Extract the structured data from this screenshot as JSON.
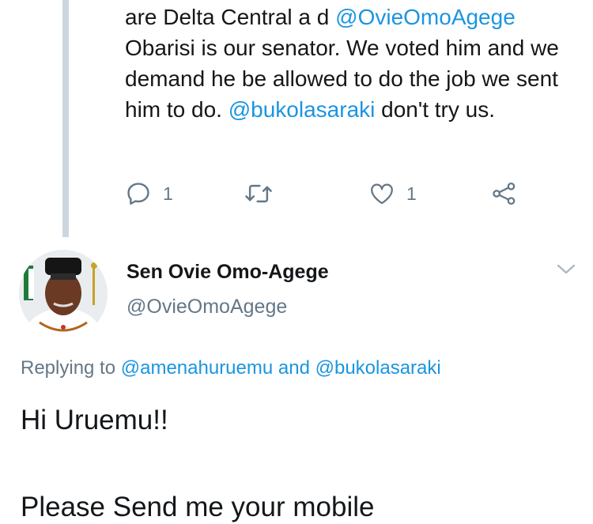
{
  "parent_tweet": {
    "text_parts": [
      {
        "t": "are Delta Central a d ",
        "mention": false
      },
      {
        "t": "@OvieOmoAgege",
        "mention": true
      },
      {
        "t": " Obarisi is our senator. We voted him and we demand he be allowed to do the job we sent him to do. ",
        "mention": false
      },
      {
        "t": "@bukolasaraki",
        "mention": true
      },
      {
        "t": " don't try us.",
        "mention": false
      }
    ],
    "reply_count": "1",
    "like_count": "1"
  },
  "reply_tweet": {
    "author_name": "Sen Ovie Omo-Agege",
    "author_handle": "@OvieOmoAgege",
    "replying_prefix": "Replying to",
    "replying_user1": "@amenahuruemu",
    "replying_and": "and",
    "replying_user2": "@bukolasaraki",
    "body_line1": "Hi Uruemu!!",
    "body_line2": "Please Send me your mobile"
  },
  "colors": {
    "link": "#1b95e0",
    "secondary_text": "#657786",
    "thread_line": "#ccd6dd"
  },
  "icons": [
    "reply-icon",
    "retweet-icon",
    "like-icon",
    "share-icon",
    "chevron-down-icon"
  ]
}
